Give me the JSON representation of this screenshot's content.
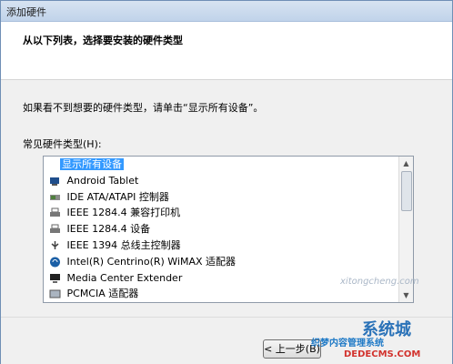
{
  "window": {
    "title": "添加硬件"
  },
  "header": {
    "heading": "从以下列表，选择要安装的硬件类型"
  },
  "body": {
    "hint": "如果看不到想要的硬件类型，请单击“显示所有设备”。",
    "list_label": "常见硬件类型(H):",
    "items": [
      {
        "label": "显示所有设备",
        "icon": "none",
        "selected": true
      },
      {
        "label": "Android Tablet",
        "icon": "device-icon"
      },
      {
        "label": "IDE ATA/ATAPI 控制器",
        "icon": "ide-controller-icon"
      },
      {
        "label": "IEEE 1284.4 兼容打印机",
        "icon": "printer-icon"
      },
      {
        "label": "IEEE 1284.4 设备",
        "icon": "printer-icon"
      },
      {
        "label": "IEEE 1394 总线主控制器",
        "icon": "firewire-icon"
      },
      {
        "label": "Intel(R) Centrino(R) WiMAX 适配器",
        "icon": "wimax-icon"
      },
      {
        "label": "Media Center Extender",
        "icon": "monitor-icon"
      },
      {
        "label": "PCMCIA 适配器",
        "icon": "pcmcia-icon"
      }
    ]
  },
  "footer": {
    "back_label": "< 上一步(B)"
  },
  "watermark": {
    "text": "织梦内容管理系统",
    "url": "DEDECMS.COM",
    "cn": "系统城",
    "small": "xitongcheng.com"
  }
}
